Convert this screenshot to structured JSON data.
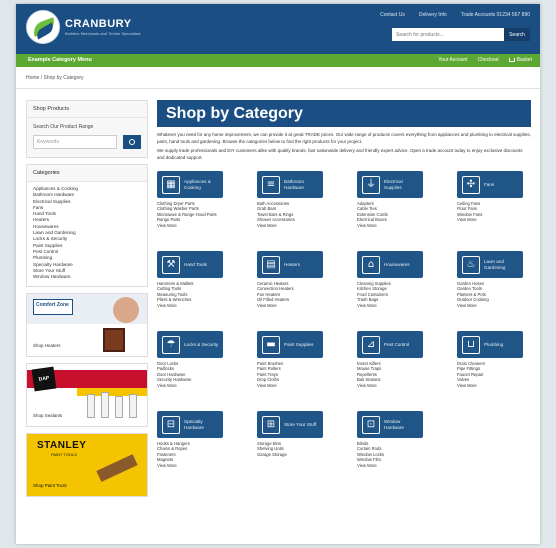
{
  "header": {
    "brand": "CRANBURY",
    "tagline": "Builders Merchants and Timber Specialists",
    "links": [
      "Contact Us",
      "Delivery Info",
      "Trade Accounts 01234 567 890"
    ],
    "search_placeholder": "Search for products...",
    "search_button": "Search"
  },
  "nav": {
    "left": "Example Category Menu",
    "right": [
      "Your Account",
      "Checkout",
      "Basket"
    ]
  },
  "breadcrumb": "Home / Shop by Category",
  "sidebar": {
    "box_title": "Shop Products",
    "search_label": "Search Our Product Range",
    "search_placeholder": "Keywords",
    "categories_title": "Categories",
    "categories": [
      "Appliances & Cooking",
      "Bathroom Hardware",
      "Electrical Supplies",
      "Fans",
      "Hand Tools",
      "Heaters",
      "Housewares",
      "Lawn and Gardening",
      "Locks & Security",
      "Paint Supplies",
      "Pest Control",
      "Plumbing",
      "Specialty Hardware",
      "Store Your Stuff",
      "Window Hardware"
    ],
    "ads": [
      {
        "name": "Comfort Zone",
        "cta": "Shop Heaters"
      },
      {
        "name": "DAP",
        "cta": "Shop Sealants"
      },
      {
        "name": "STANLEY",
        "sub": "PAINT TOOLS",
        "cta": "Shop Paint Tools"
      }
    ]
  },
  "main": {
    "title": "Shop by Category",
    "intro": [
      "Whatever you need for any home improvement, we can provide it at great TRADE prices. Our wide range of products covers everything from appliances and plumbing to electrical supplies, paint, hand tools and gardening. Browse the categories below to find the right products for your project.",
      "We supply trade professionals and DIY customers alike with quality brands, fast nationwide delivery and friendly expert advice. Open a trade account today to enjoy exclusive discounts and dedicated support."
    ],
    "categories": [
      {
        "title": "Appliances & Cooking",
        "icon": "stove-icon",
        "glyph": "▦",
        "subs": [
          "Clothing Dryer Parts",
          "Clothing Washer Parts",
          "Microwave & Range Hood Parts",
          "Range Parts",
          "View More"
        ]
      },
      {
        "title": "Bathroom Hardware",
        "icon": "towel-rack-icon",
        "glyph": "≡",
        "subs": [
          "Bath Accessories",
          "Grab Bars",
          "Towel Bars & Rings",
          "Shower Accessories",
          "View More"
        ]
      },
      {
        "title": "Electrical Supplies",
        "icon": "plug-icon",
        "glyph": "⏚",
        "subs": [
          "Adapters",
          "Cable Ties",
          "Extension Cords",
          "Electrical Boxes",
          "View More"
        ]
      },
      {
        "title": "Fans",
        "icon": "fan-icon",
        "glyph": "✣",
        "subs": [
          "Ceiling Fans",
          "Floor Fans",
          "Window Fans",
          "View More"
        ]
      },
      {
        "title": "Hand Tools",
        "icon": "tools-icon",
        "glyph": "⚒",
        "subs": [
          "Hammers & Mallets",
          "Cutting Tools",
          "Measuring Tools",
          "Pliers & Wrenches",
          "View More"
        ]
      },
      {
        "title": "Heaters",
        "icon": "heater-icon",
        "glyph": "▤",
        "subs": [
          "Ceramic Heaters",
          "Convection Heaters",
          "Fan Heaters",
          "Oil Filled Heaters",
          "View More"
        ]
      },
      {
        "title": "Housewares",
        "icon": "house-icon",
        "glyph": "⌂",
        "subs": [
          "Cleaning Supplies",
          "Kitchen Storage",
          "Food Containers",
          "Trash Bags",
          "View More"
        ]
      },
      {
        "title": "Lawn and Gardening",
        "icon": "grill-icon",
        "glyph": "♨",
        "subs": [
          "Garden Hoses",
          "Garden Tools",
          "Planters & Pots",
          "Outdoor Cooking",
          "View More"
        ]
      },
      {
        "title": "Locks & Security",
        "icon": "watering-can-icon",
        "glyph": "☂",
        "subs": [
          "Door Locks",
          "Padlocks",
          "Door Hardware",
          "Security Hardware",
          "View More"
        ]
      },
      {
        "title": "Paint Supplies",
        "icon": "paint-roller-icon",
        "glyph": "▬",
        "subs": [
          "Paint Brushes",
          "Paint Rollers",
          "Paint Trays",
          "Drop Cloths",
          "View More"
        ]
      },
      {
        "title": "Pest Control",
        "icon": "spray-icon",
        "glyph": "⊿",
        "subs": [
          "Insect Killers",
          "Mouse Traps",
          "Repellents",
          "Bait Stations",
          "View More"
        ]
      },
      {
        "title": "Plumbing",
        "icon": "pipe-icon",
        "glyph": "⊔",
        "subs": [
          "Drain Cleaners",
          "Pipe Fittings",
          "Faucet Repair",
          "Valves",
          "View More"
        ]
      },
      {
        "title": "Specialty Hardware",
        "icon": "padlock-icon",
        "glyph": "⊟",
        "subs": [
          "Hooks & Hangers",
          "Chains & Ropes",
          "Fasteners",
          "Magnets",
          "View More"
        ]
      },
      {
        "title": "Store Your Stuff",
        "icon": "storage-icon",
        "glyph": "⊞",
        "subs": [
          "Storage Bins",
          "Shelving Units",
          "Garage Storage"
        ]
      },
      {
        "title": "Window Hardware",
        "icon": "window-icon",
        "glyph": "⊡",
        "subs": [
          "Blinds",
          "Curtain Rods",
          "Window Locks",
          "Window Film",
          "View More"
        ]
      }
    ]
  },
  "colors": {
    "primary": "#1b4f83",
    "accent": "#5da832",
    "tile": "#1f5587"
  }
}
